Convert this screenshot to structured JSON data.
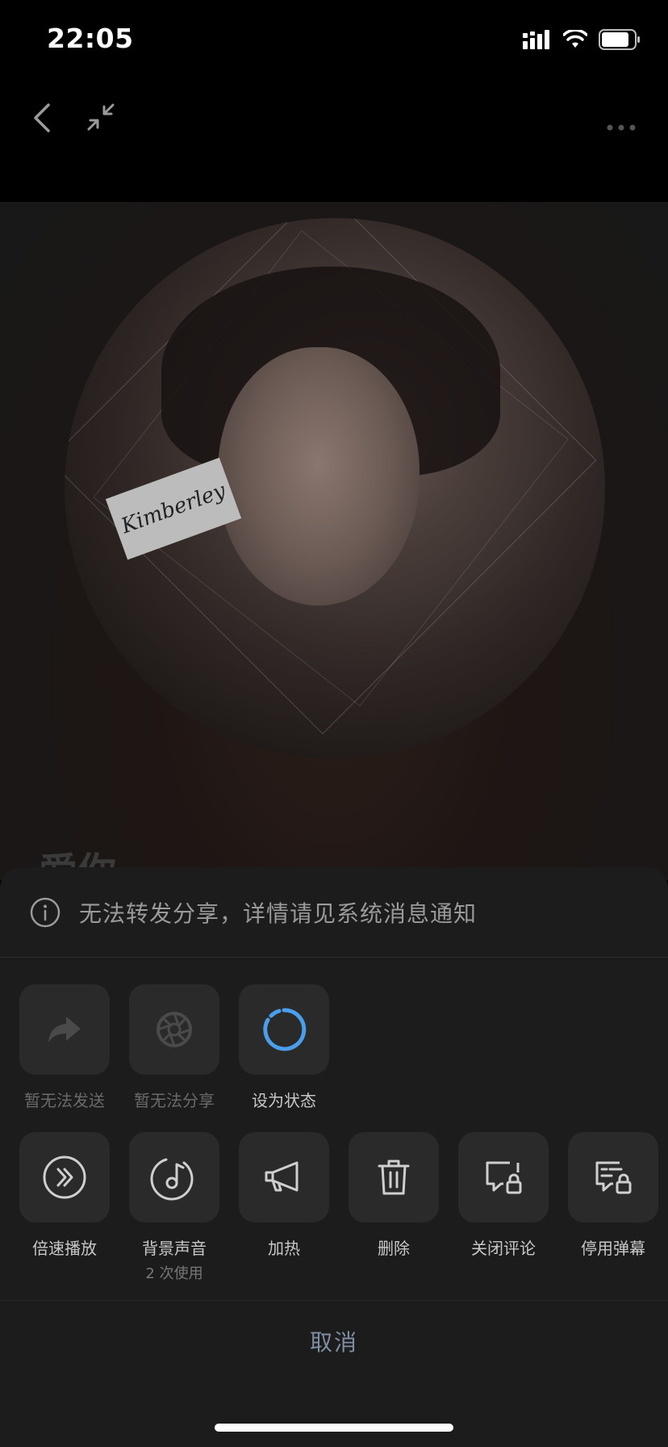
{
  "status_bar": {
    "time": "22:05",
    "icons": [
      "signal-icon",
      "wifi-icon",
      "battery-icon"
    ]
  },
  "top_nav": {
    "icons": [
      "back-chevron-icon",
      "shrink-arrows-icon",
      "more-dots-icon"
    ]
  },
  "media": {
    "cover_text": "Kimberley",
    "title": "爱你"
  },
  "sheet": {
    "notice": "无法转发分享，详情请见系统消息通知",
    "row1": [
      {
        "label": "暂无法发送",
        "icon": "forward-arrow-icon",
        "disabled": true
      },
      {
        "label": "暂无法分享",
        "icon": "shutter-icon",
        "disabled": true
      },
      {
        "label": "设为状态",
        "icon": "status-ring-icon",
        "disabled": false
      }
    ],
    "row2": [
      {
        "label": "倍速播放",
        "icon": "fast-forward-icon"
      },
      {
        "label": "背景声音",
        "sub": "2 次使用",
        "icon": "music-note-icon"
      },
      {
        "label": "加热",
        "icon": "megaphone-icon"
      },
      {
        "label": "删除",
        "icon": "trash-icon"
      },
      {
        "label": "关闭评论",
        "icon": "comment-lock-icon"
      },
      {
        "label": "停用弹幕",
        "icon": "danmaku-lock-icon"
      }
    ],
    "cancel": "取消"
  },
  "colors": {
    "accent_ring": "#4a9eea",
    "sheet_bg": "#1c1c1c",
    "tile_bg": "#2a2a2a",
    "cancel_text": "#7f8ea3"
  }
}
